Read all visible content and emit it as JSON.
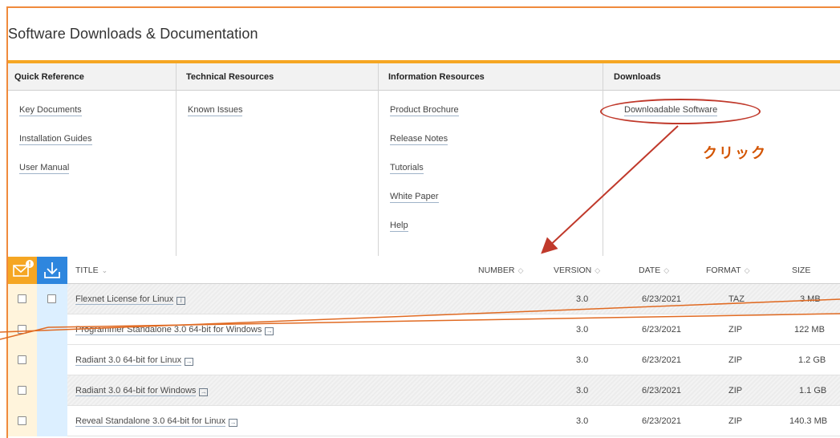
{
  "header": {
    "title": "Software Downloads & Documentation"
  },
  "columns": {
    "quick_reference": {
      "heading": "Quick Reference",
      "links": [
        "Key Documents",
        "Installation Guides",
        "User Manual"
      ]
    },
    "technical_resources": {
      "heading": "Technical Resources",
      "links": [
        "Known Issues"
      ]
    },
    "information_resources": {
      "heading": "Information Resources",
      "links": [
        "Product Brochure",
        "Release Notes",
        "Tutorials",
        "White Paper",
        "Help"
      ]
    },
    "downloads": {
      "heading": "Downloads",
      "links": [
        "Downloadable Software"
      ]
    }
  },
  "annotation": {
    "text": "クリック",
    "color": "#d35400"
  },
  "table": {
    "headers": {
      "title": "TITLE",
      "number": "NUMBER",
      "version": "VERSION",
      "date": "DATE",
      "format": "FORMAT",
      "size": "SIZE"
    },
    "icons": {
      "mail": "mail-notify-icon",
      "download": "download-icon"
    },
    "rows": [
      {
        "title": "Flexnet License for Linux",
        "version": "3.0",
        "date": "6/23/2021",
        "format": "TAZ",
        "size": "3 MB"
      },
      {
        "title": "Programmer Standalone 3.0 64-bit for Windows",
        "version": "3.0",
        "date": "6/23/2021",
        "format": "ZIP",
        "size": "122 MB"
      },
      {
        "title": "Radiant 3.0 64-bit for Linux",
        "version": "3.0",
        "date": "6/23/2021",
        "format": "ZIP",
        "size": "1.2 GB"
      },
      {
        "title": "Radiant 3.0 64-bit for Windows",
        "version": "3.0",
        "date": "6/23/2021",
        "format": "ZIP",
        "size": "1.1 GB"
      },
      {
        "title": "Reveal Standalone 3.0 64-bit for Linux",
        "version": "3.0",
        "date": "6/23/2021",
        "format": "ZIP",
        "size": "140.3 MB"
      }
    ]
  },
  "colors": {
    "accent": "#f5a623",
    "frame": "#f08a3c",
    "highlight": "#c0392b",
    "download_blue": "#2e86de"
  }
}
